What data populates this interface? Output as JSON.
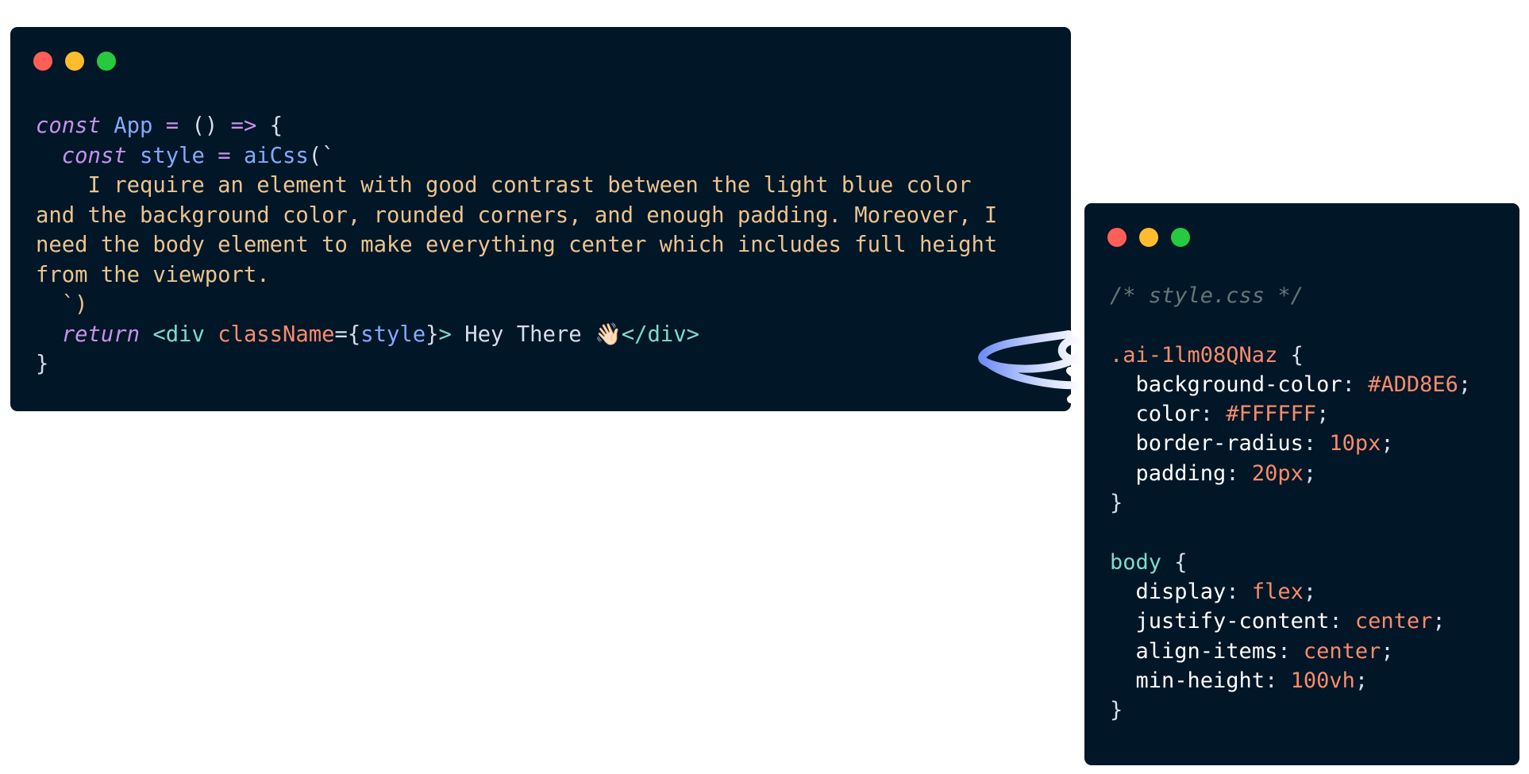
{
  "js_window": {
    "lines": [
      {
        "kw": "const",
        "id": "App",
        "op1": "=",
        "paren": "()",
        "op2": "=>",
        "brace": "{"
      },
      {
        "indent": "  ",
        "kw": "const",
        "id": "style",
        "op": "=",
        "fn": "aiCss",
        "open": "(`"
      },
      "    I require an element with good contrast between the light blue color",
      "and the background color, rounded corners, and enough padding. Moreover, I",
      "need the body element to make everything center which includes full height",
      "from the viewport.",
      "  `)",
      {
        "indent": "  ",
        "kw": "return",
        "tag_open": "<div",
        "attr": "className",
        "eq": "=",
        "lbrace": "{",
        "var": "style",
        "rbrace": "}",
        "tag_close_open": ">",
        "text": " Hey There ",
        "emoji": "👋🏻",
        "tag_end": "</div>"
      },
      "}"
    ]
  },
  "css_window": {
    "comment": "/* style.css */",
    "rules": [
      {
        "selector": ".ai-1lm08QNaz",
        "decls": [
          {
            "prop": "background-color",
            "value": "#ADD8E6"
          },
          {
            "prop": "color",
            "value": "#FFFFFF"
          },
          {
            "prop": "border-radius",
            "value": "10px"
          },
          {
            "prop": "padding",
            "value": "20px"
          }
        ]
      },
      {
        "selector": "body",
        "decls": [
          {
            "prop": "display",
            "value": "flex"
          },
          {
            "prop": "justify-content",
            "value": "center"
          },
          {
            "prop": "align-items",
            "value": "center"
          },
          {
            "prop": "min-height",
            "value": "100vh"
          }
        ]
      }
    ]
  },
  "colors": {
    "window_bg": "#011627",
    "dot_red": "#ff5f56",
    "dot_yellow": "#ffbd2e",
    "dot_green": "#27c93f",
    "arrow_gradient_start": "#6f8ef5",
    "arrow_gradient_end": "#ffffff"
  },
  "icons": [
    "close-dot-icon",
    "minimize-dot-icon",
    "maximize-dot-icon",
    "curly-arrow-icon",
    "waving-hand-icon"
  ]
}
